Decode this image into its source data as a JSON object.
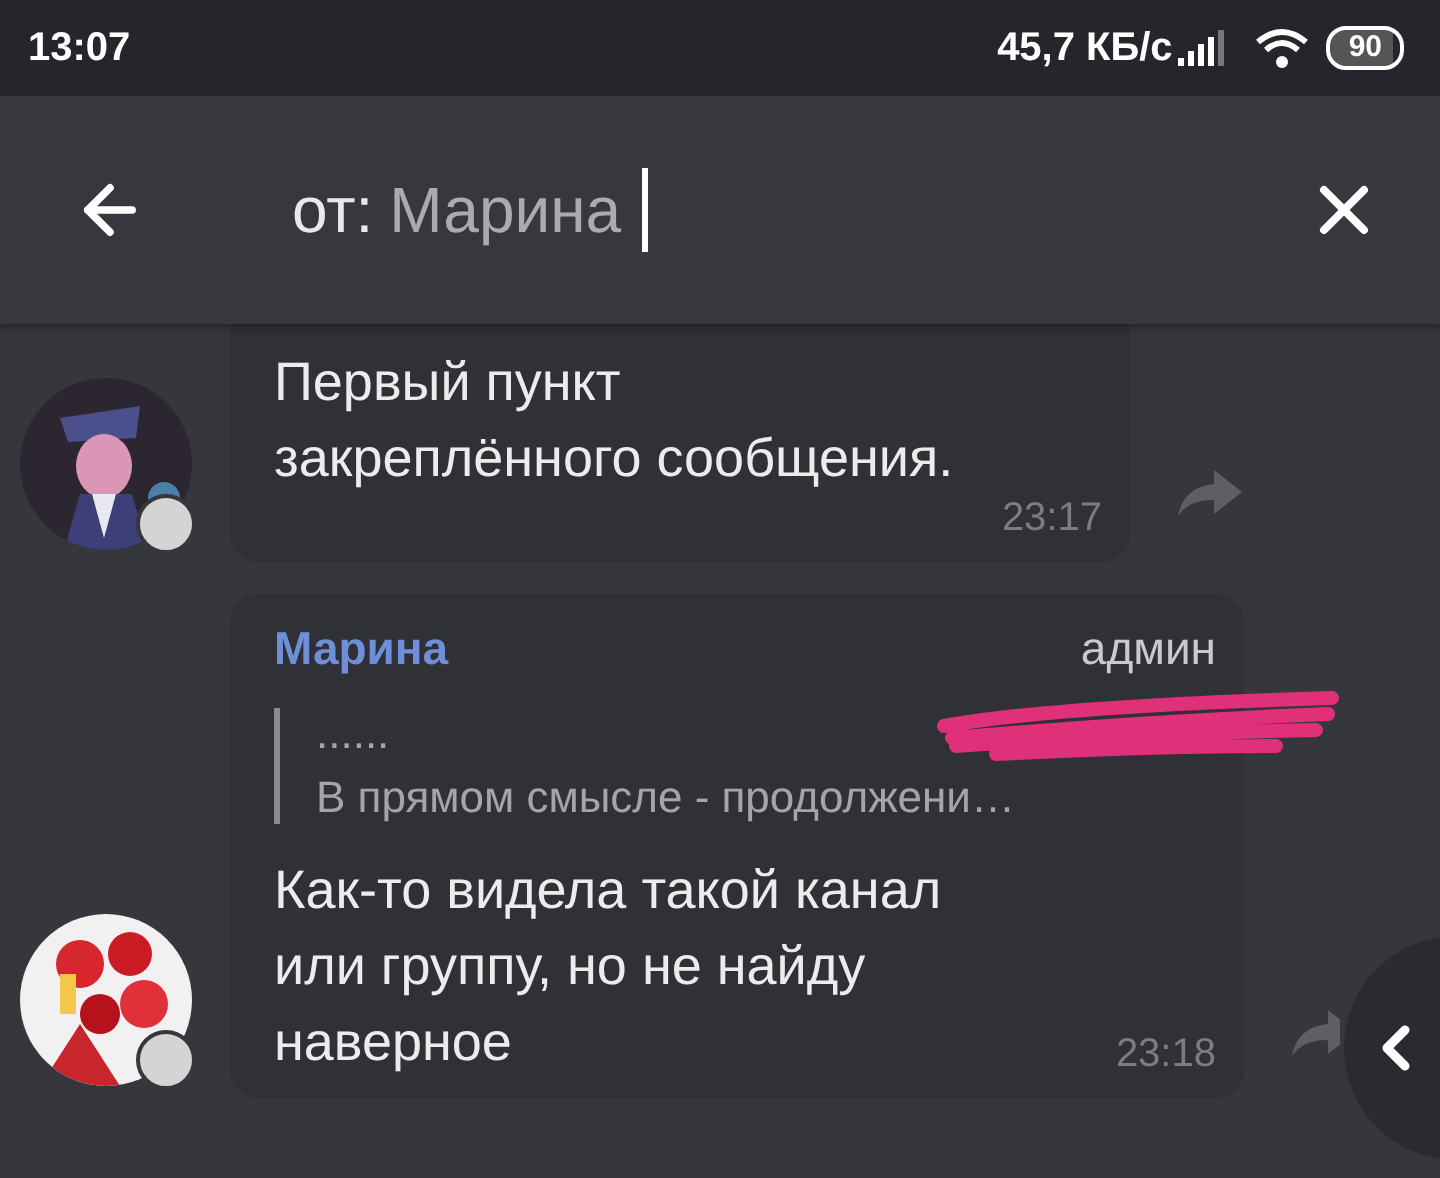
{
  "status_bar": {
    "time": "13:07",
    "speed": "45,7 КБ/с",
    "battery": "90"
  },
  "search": {
    "prefix": "от:",
    "value": "Марина"
  },
  "messages": [
    {
      "text": "Первый пункт\nзакреплённого сообщения.",
      "time": "23:17"
    },
    {
      "author": "Марина",
      "role": "админ",
      "quote": {
        "title": "......",
        "text": "В прямом смысле - продолжени…"
      },
      "text": "Как-то видела такой канал\nили группу, но не найду\nнаверное",
      "time": "23:18"
    }
  ]
}
